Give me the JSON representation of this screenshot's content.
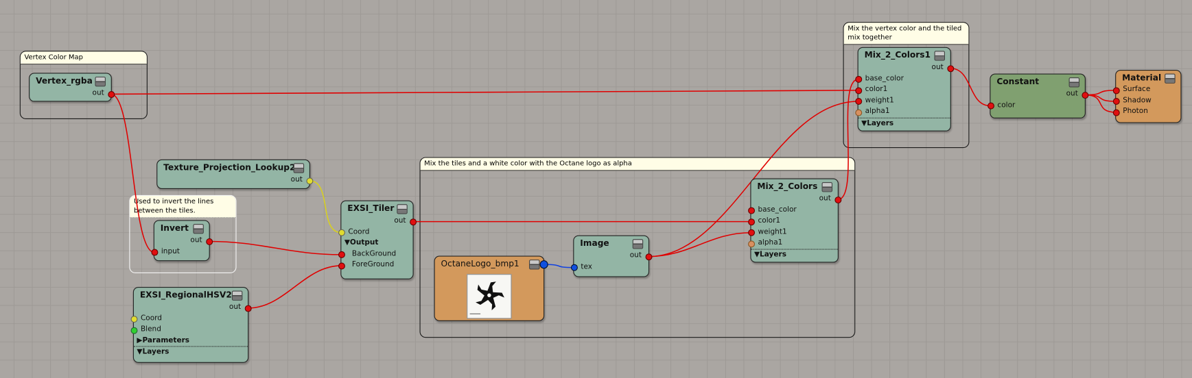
{
  "frames": {
    "vertex": "Vertex Color Map",
    "invert": "Used to invert the lines between the tiles.",
    "tiles": "Mix the tiles and a white color with the Octane logo as alpha",
    "mix_vertex": "Mix the vertex color and the tiled mix together"
  },
  "nodes": {
    "vertex_rgba": {
      "title": "Vertex_rgba",
      "out": "out"
    },
    "tpl": {
      "title": "Texture_Projection_Lookup2",
      "out": "out"
    },
    "invert": {
      "title": "Invert",
      "out": "out",
      "input": "input"
    },
    "tiler": {
      "title": "EXSI_Tiler",
      "out": "out",
      "coord": "Coord",
      "output": "▼Output",
      "background": "BackGround",
      "foreground": "ForeGround"
    },
    "hsv": {
      "title": "EXSI_RegionalHSV2",
      "out": "out",
      "coord": "Coord",
      "blend": "Blend",
      "parameters": "▶Parameters",
      "layers": "▼Layers"
    },
    "octane_logo": {
      "title": "OctaneLogo_bmp1"
    },
    "image": {
      "title": "Image",
      "out": "out",
      "tex": "tex"
    },
    "mix": {
      "title": "Mix_2_Colors",
      "out": "out",
      "base_color": "base_color",
      "color1": "color1",
      "weight1": "weight1",
      "alpha1": "alpha1",
      "layers": "▼Layers"
    },
    "mix1": {
      "title": "Mix_2_Colors1",
      "out": "out",
      "base_color": "base_color",
      "color1": "color1",
      "weight1": "weight1",
      "alpha1": "alpha1",
      "layers": "▼Layers"
    },
    "constant": {
      "title": "Constant",
      "out": "out",
      "color": "color"
    },
    "material": {
      "title": "Material",
      "surface": "Surface",
      "shadow": "Shadow",
      "photon": "Photon"
    }
  },
  "wires": [
    {
      "from": "vertex_rgba.out",
      "to": "mix1.color1",
      "color": "#e00000"
    },
    {
      "from": "vertex_rgba.out",
      "to": "invert.input",
      "color": "#e00000"
    },
    {
      "from": "tpl.out",
      "to": "tiler.coord",
      "color": "#d8d020"
    },
    {
      "from": "invert.out",
      "to": "tiler.background",
      "color": "#e00000"
    },
    {
      "from": "hsv.out",
      "to": "tiler.foreground",
      "color": "#e00000"
    },
    {
      "from": "tiler.out",
      "to": "mix.color1",
      "color": "#e00000"
    },
    {
      "from": "octane_logo.out",
      "to": "image.tex",
      "color": "#1040e0"
    },
    {
      "from": "image.out",
      "to": "mix.weight1",
      "color": "#e00000"
    },
    {
      "from": "image.out",
      "to": "mix1.weight1",
      "color": "#e00000"
    },
    {
      "from": "mix.out",
      "to": "mix1.base_color",
      "color": "#e00000"
    },
    {
      "from": "mix1.out",
      "to": "constant.color",
      "color": "#e00000"
    },
    {
      "from": "constant.out",
      "to": "material.surface",
      "color": "#e00000"
    },
    {
      "from": "constant.out",
      "to": "material.shadow",
      "color": "#e00000"
    },
    {
      "from": "constant.out",
      "to": "material.photon",
      "color": "#e00000"
    }
  ]
}
